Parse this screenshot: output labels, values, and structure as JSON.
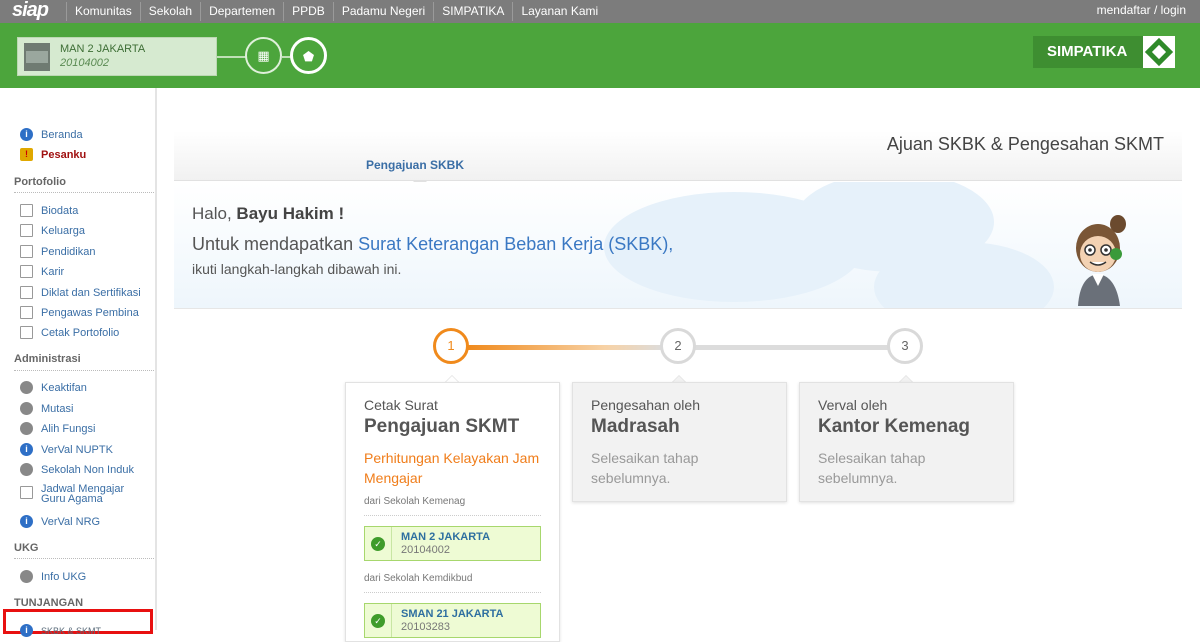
{
  "topbar": {
    "logo": "siap",
    "nav": [
      "Komunitas",
      "Sekolah",
      "Departemen",
      "PPDB",
      "Padamu Negeri",
      "SIMPATIKA",
      "Layanan Kami"
    ],
    "login": "mendaftar / login"
  },
  "header": {
    "school_name": "MAN 2 JAKARTA",
    "school_npsn": "20104002",
    "brand": "SIMPATIKA",
    "colors": {
      "green": "#4ca53c",
      "orange": "#f08a1c",
      "link": "#3a78c3"
    }
  },
  "sidebar": {
    "top": [
      {
        "label": "Beranda",
        "icon": "info-icon"
      },
      {
        "label": "Pesanku",
        "icon": "mail-alert-icon"
      }
    ],
    "sections": [
      {
        "title": "Portofolio",
        "items": [
          "Biodata",
          "Keluarga",
          "Pendidikan",
          "Karir",
          "Diklat dan Sertifikasi",
          "Pengawas Pembina",
          "Cetak Portofolio"
        ]
      },
      {
        "title": "Administrasi",
        "items": [
          "Keaktifan",
          "Mutasi",
          "Alih Fungsi",
          "VerVal NUPTK",
          "Sekolah Non Induk",
          "Jadwal Mengajar Guru Agama",
          "VerVal NRG"
        ]
      },
      {
        "title": "UKG",
        "items": [
          "Info UKG"
        ]
      },
      {
        "title": "TUNJANGAN",
        "items": [
          "SKBK & SKMT"
        ]
      }
    ]
  },
  "content": {
    "title": "Ajuan SKBK & Pengesahan SKMT",
    "tab": "Pengajuan SKBK",
    "greeting_prefix": "Halo,",
    "greeting_name": "Bayu Hakim !",
    "line2_prefix": "Untuk mendapatkan",
    "line2_highlight": "Surat Keterangan Beban Kerja (SKBK),",
    "line3": "ikuti langkah-langkah dibawah ini."
  },
  "steps": [
    {
      "num": "1",
      "pre": "Cetak Surat",
      "title": "Pengajuan SKMT",
      "link": "Perhitungan Kelayakan Jam Mengajar",
      "groups": [
        {
          "label": "dari Sekolah Kemenag",
          "school": "MAN 2 JAKARTA",
          "npsn": "20104002"
        },
        {
          "label": "dari Sekolah Kemdikbud",
          "school": "SMAN 21 JAKARTA",
          "npsn": "20103283"
        }
      ]
    },
    {
      "num": "2",
      "pre": "Pengesahan oleh",
      "title": "Madrasah",
      "desc": "Selesaikan tahap sebelumnya."
    },
    {
      "num": "3",
      "pre": "Verval oleh",
      "title": "Kantor Kemenag",
      "desc": "Selesaikan tahap sebelumnya."
    }
  ]
}
